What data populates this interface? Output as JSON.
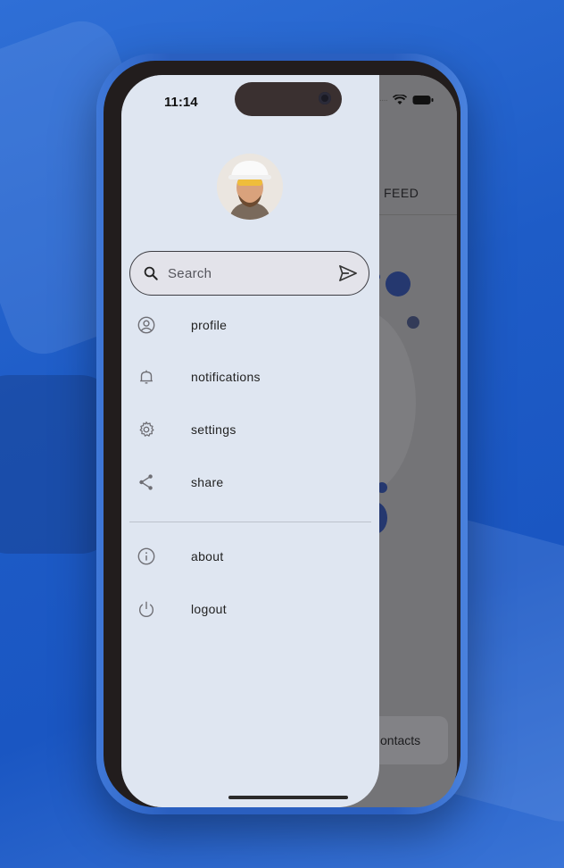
{
  "status_bar": {
    "time": "11:14"
  },
  "background_app": {
    "tab_label": "FEED",
    "contacts_button": "ontacts"
  },
  "drawer": {
    "search": {
      "placeholder": "Search"
    },
    "menu": [
      {
        "label": "profile",
        "icon": "account-circle-icon"
      },
      {
        "label": "notifications",
        "icon": "bell-icon"
      },
      {
        "label": "settings",
        "icon": "gear-icon"
      },
      {
        "label": "share",
        "icon": "share-icon"
      }
    ],
    "menu_secondary": [
      {
        "label": "about",
        "icon": "info-icon"
      },
      {
        "label": "logout",
        "icon": "power-icon"
      }
    ]
  },
  "colors": {
    "background": "#1e5cc7",
    "drawer": "#dfe6f1",
    "scrim": "#747477",
    "accent_dots": "#25386f"
  }
}
